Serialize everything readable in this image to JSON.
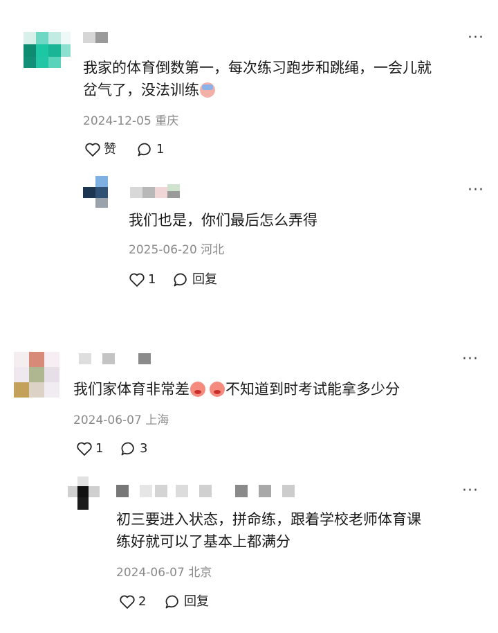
{
  "comments": [
    {
      "text_line1": "我家的体育倒数第一，每次练习跑步和跳绳，一会儿就",
      "text_line2": "岔气了，没法训练",
      "emoji": "crying-emoji",
      "date": "2024-12-05",
      "location": "重庆",
      "like_label": "赞",
      "reply_count": "1"
    },
    {
      "text": "我们也是，你们最后怎么弄得",
      "date": "2025-06-20",
      "location": "河北",
      "like_count": "1",
      "reply_label": "回复"
    },
    {
      "text_before": "我们家体育非常差",
      "emojis": [
        "angry-emoji",
        "angry-emoji"
      ],
      "text_after": "不知道到时考试能拿多少分",
      "date": "2024-06-07",
      "location": "上海",
      "like_count": "1",
      "reply_count": "3"
    },
    {
      "text_line1": "初三要进入状态，拼命练，跟着学校老师体育课",
      "text_line2": "练好就可以了基本上都满分",
      "date": "2024-06-07",
      "location": "北京",
      "like_count": "2",
      "reply_label": "回复"
    }
  ],
  "more_label": "···",
  "colors": {
    "meta_gray": "#8a8a8a",
    "avatar1": "#1cc7a4",
    "avatar2": "#1c3550",
    "avatar4": "#111111"
  }
}
